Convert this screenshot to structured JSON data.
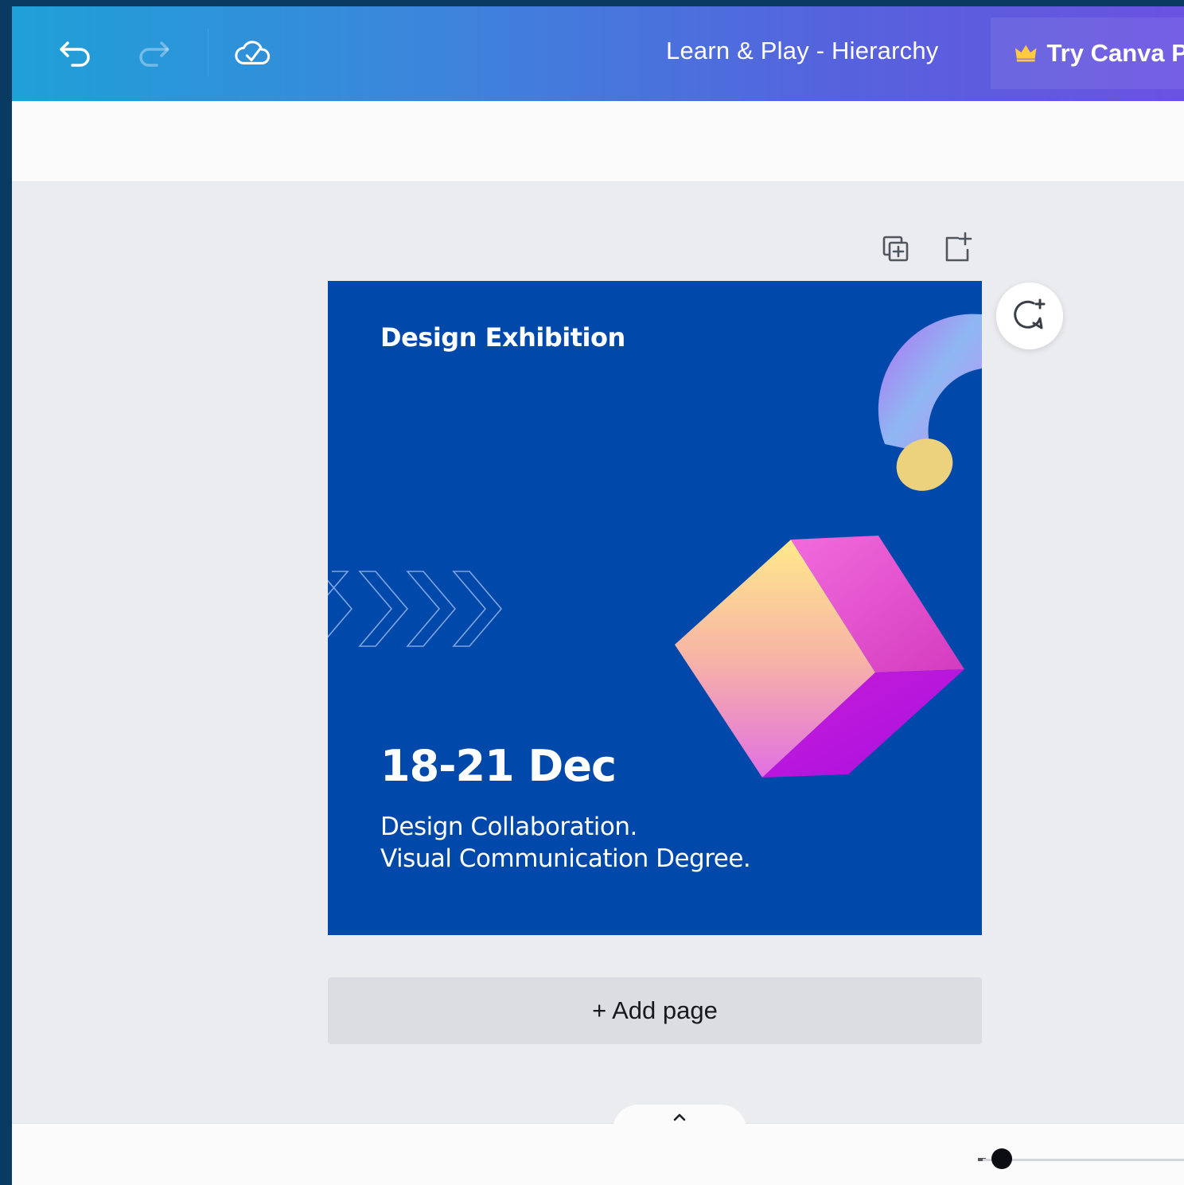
{
  "topbar": {
    "undo_icon": "undo-icon",
    "redo_icon": "redo-icon",
    "save_status_icon": "cloud-check-icon",
    "document_title": "Learn & Play - Hierarchy",
    "try_pro_label": "Try Canva Pr",
    "try_pro_icon": "crown-icon"
  },
  "page_actions": {
    "duplicate_icon": "duplicate-page-icon",
    "add_icon": "add-page-icon"
  },
  "design": {
    "heading": "Design Exhibition",
    "date": "18-21 Dec",
    "line1": "Design Collaboration.",
    "line2": "Visual Communication Degree.",
    "background_color": "#0049ab"
  },
  "comment_icon": "add-comment-icon",
  "add_page_label": "+ Add page",
  "bottom": {
    "collapse_icon": "chevron-up-icon",
    "zoom_level": 0.1
  }
}
